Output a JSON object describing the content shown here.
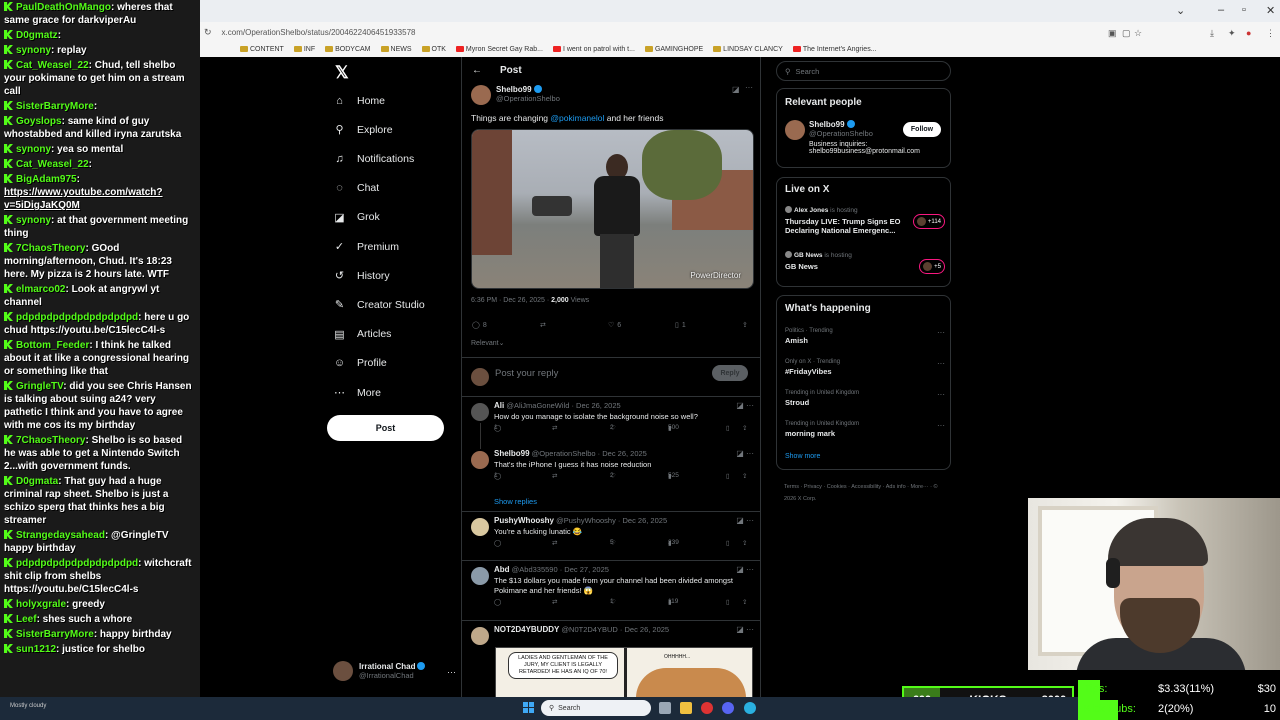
{
  "chat": {
    "messages": [
      {
        "user": "PaulDeathOnMango",
        "text": "wheres that same grace for darkviperAu"
      },
      {
        "user": "D0gmatz",
        "text": ""
      },
      {
        "user": "synony",
        "text": "replay"
      },
      {
        "user": "Cat_Weasel_22",
        "text": "Chud, tell shelbo your pokimane to get him on a stream call"
      },
      {
        "user": "SisterBarryMore",
        "text": ""
      },
      {
        "user": "Goyslops",
        "text": "same kind of guy whostabbed and killed iryna zarutska"
      },
      {
        "user": "synony",
        "text": "yea so mental"
      },
      {
        "user": "Cat_Weasel_22",
        "text": ""
      },
      {
        "user": "BigAdam975",
        "text": "https://www.youtube.com/watch?v=5iDigJaKQ0M",
        "link": true
      },
      {
        "user": "synony",
        "text": "at that government meeting thing"
      },
      {
        "user": "7ChaosTheory",
        "text": "GOod morning/afternoon, Chud. It's 18:23 here. My pizza is 2 hours late. WTF"
      },
      {
        "user": "elmarco02",
        "text": "Look at angrywl yt channel"
      },
      {
        "user": "pdpdpdpdpdpdpdpdpdpd",
        "text": "here u go chud https://youtu.be/C15lecC4l-s"
      },
      {
        "user": "Bottom_Feeder",
        "text": "I think he talked about it at like a congressional hearing or something like that"
      },
      {
        "user": "GringleTV",
        "text": "did you see Chris Hansen is talking about suing a24? very pathetic I think and you have to agree with me cos its my birthday"
      },
      {
        "user": "7ChaosTheory",
        "text": "Shelbo is so based he was able to get a Nintendo Switch 2...with government funds."
      },
      {
        "user": "D0gmata",
        "text": "That guy had a huge criminal rap sheet. Shelbo is just a schizo sperg that thinks hes a big streamer"
      },
      {
        "user": "Strangedaysahead",
        "text": "@GringleTV happy birthday"
      },
      {
        "user": "pdpdpdpdpdpdpdpdpdpd",
        "text": "witchcraft shit clip from shelbs https://youtu.be/C15lecC4l-s"
      },
      {
        "user": "holyxgrale",
        "text": "greedy"
      },
      {
        "user": "Leef",
        "text": "shes such a whore"
      },
      {
        "user": "SisterBarryMore",
        "text": "happy birthday"
      },
      {
        "user": "sun1212",
        "text": "justice for shelbo"
      }
    ]
  },
  "browser": {
    "url": "x.com/OperationShelbo/status/2004622406451933578",
    "bookmarks": [
      "Myron Secret Gay Rab...",
      "I went on patrol with t...",
      "GAMINGHOPE",
      "LINDSAY CLANCY",
      "The Internet's Angries..."
    ],
    "bookmarks_left": [
      "CONTENT",
      "INF",
      "BODYCAM",
      "NEWS",
      "OTK"
    ]
  },
  "nav": {
    "logo": "𝕏",
    "items": [
      {
        "label": "Home",
        "icon": "home-icon",
        "glyph": "⌂"
      },
      {
        "label": "Explore",
        "icon": "search-icon",
        "glyph": "⚲"
      },
      {
        "label": "Notifications",
        "icon": "bell-icon",
        "glyph": "♫"
      },
      {
        "label": "Chat",
        "icon": "chat-icon",
        "glyph": "◌"
      },
      {
        "label": "Grok",
        "icon": "grok-icon",
        "glyph": "◪"
      },
      {
        "label": "Premium",
        "icon": "premium-icon",
        "glyph": "✓"
      },
      {
        "label": "History",
        "icon": "history-icon",
        "glyph": "↺"
      },
      {
        "label": "Creator Studio",
        "icon": "creator-icon",
        "glyph": "✎"
      },
      {
        "label": "Articles",
        "icon": "articles-icon",
        "glyph": "▤"
      },
      {
        "label": "Profile",
        "icon": "profile-icon",
        "glyph": "☺"
      },
      {
        "label": "More",
        "icon": "more-icon",
        "glyph": "⋯"
      }
    ],
    "post_label": "Post",
    "me": {
      "name": "Irrational Chad",
      "handle": "@IrrationalChad"
    }
  },
  "post": {
    "header": "Post",
    "author": {
      "name": "Shelbo99",
      "handle": "@OperationShelbo"
    },
    "text_before": "Things are changing ",
    "mention": "@pokimanelol",
    "text_after": " and her friends",
    "watermark": "PowerDirector",
    "time": "6:36 PM · Dec 26, 2025 · ",
    "views_count": "2,000",
    "views_label": " Views",
    "replies": "8",
    "likes": "6",
    "bookmarks": "1",
    "sort": "Relevant",
    "reply_placeholder": "Post your reply",
    "reply_button": "Reply"
  },
  "replies": [
    {
      "name": "Ali",
      "handle": "@AliJmaGoneWild · Dec 26, 2025",
      "text": "How do you manage to isolate the background noise so well?",
      "rep": "1",
      "like": "2",
      "views": "500"
    },
    {
      "name": "Shelbo99",
      "handle": "@OperationShelbo · Dec 26, 2025",
      "text": "That's the iPhone I guess it has noise reduction",
      "rep": "1",
      "like": "2",
      "views": "525"
    },
    {
      "name": "PushyWhooshy",
      "handle": "@PushyWhooshy · Dec 26, 2025",
      "text": "You're a fucking lunatic 😂",
      "rep": "",
      "like": "5",
      "views": "239"
    },
    {
      "name": "Abd",
      "handle": "@Abd335590 · Dec 27, 2025",
      "text": "The $13 dollars you made from your channel had been divided amongst Pokimane and her friends! 😱",
      "rep": "",
      "like": "1",
      "views": "119"
    },
    {
      "name": "NOT2D4YBUDDY",
      "handle": "@N0T2D4YBUD · Dec 26, 2025",
      "text": "",
      "rep": "",
      "like": "",
      "views": ""
    }
  ],
  "show_replies": "Show replies",
  "comic": {
    "bubble": "LADIES AND GENTLEMAN OF THE JURY, MY CLIENT IS LEGALLY RETARDED! HE HAS AN IQ OF 70!",
    "bubble2": "OHHHHH..."
  },
  "right": {
    "search_placeholder": "Search",
    "relevant_title": "Relevant people",
    "person": {
      "name": "Shelbo99",
      "handle": "@OperationShelbo",
      "bio1": "Business inquiries:",
      "bio2": "shelbo99business@protonmail.com"
    },
    "follow": "Follow",
    "live_title": "Live on X",
    "live": [
      {
        "host": "Alex Jones",
        "hosting": " is hosting",
        "title": "Thursday LIVE: Trump Signs EO Declaring National Emergenc...",
        "badge": "+114"
      },
      {
        "host": "GB News",
        "hosting": " is hosting",
        "title": "GB News",
        "badge": "+5"
      }
    ],
    "happening_title": "What's happening",
    "trends": [
      {
        "cat": "Politics · Trending",
        "name": "Amish"
      },
      {
        "cat": "Only on X · Trending",
        "name": "#FridayVibes"
      },
      {
        "cat": "Trending in United Kingdom",
        "name": "Stroud"
      },
      {
        "cat": "Trending in United Kingdom",
        "name": "morning mark"
      }
    ],
    "show_more": "Show more",
    "footer": "Terms · Privacy · Cookies · Accessibility · Ads info · More··· · © 2026 X Corp."
  },
  "kicks": {
    "left": "600",
    "label": "KICKS",
    "right": "3000",
    "progress": 0.2
  },
  "tips": [
    {
      "label": "Tips:",
      "value": "$3.33(11%)",
      "goal": "$30",
      "percent": 11
    },
    {
      "label": "Kick Subs:",
      "value": "2(20%)",
      "goal": "10",
      "percent": 20
    }
  ],
  "taskbar": {
    "search": "Search",
    "weather": "Mostly cloudy"
  },
  "colors": {
    "kick_green": "#53fc18",
    "x_blue": "#1d9bf0"
  }
}
